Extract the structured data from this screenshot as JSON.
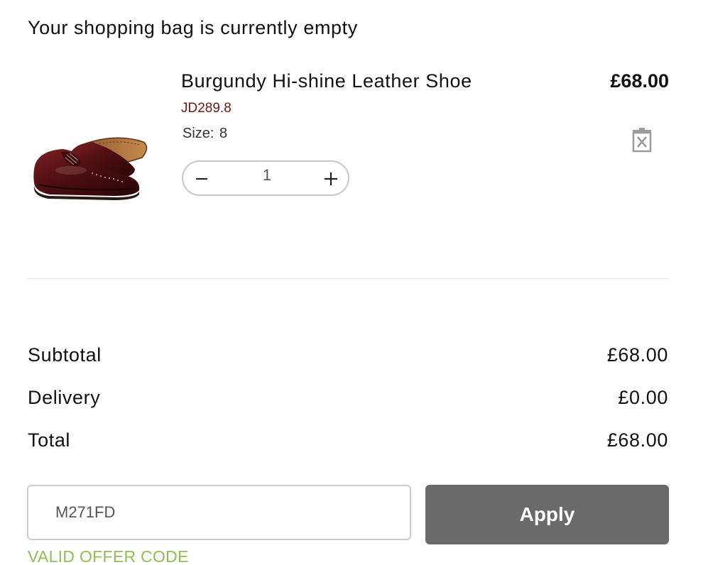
{
  "bag": {
    "heading": "Your shopping bag is currently empty"
  },
  "item": {
    "name": "Burgundy Hi-shine Leather Shoe",
    "sku": "JD289.8",
    "size_label": "Size:",
    "size_value": "8",
    "price": "£68.00",
    "quantity": "1",
    "image_icon": "burgundy-brogue-shoe-image",
    "delete_icon": "trash-icon"
  },
  "summary": {
    "subtotal_label": "Subtotal",
    "subtotal_value": "£68.00",
    "delivery_label": "Delivery",
    "delivery_value": "£0.00",
    "total_label": "Total",
    "total_value": "£68.00"
  },
  "offer": {
    "code_value": "M271FD",
    "apply_label": "Apply",
    "status_text": "VALID OFFER CODE"
  },
  "colors": {
    "sku": "#6b1712",
    "apply_bg": "#6a6a6a",
    "valid_status": "#8cc152"
  }
}
